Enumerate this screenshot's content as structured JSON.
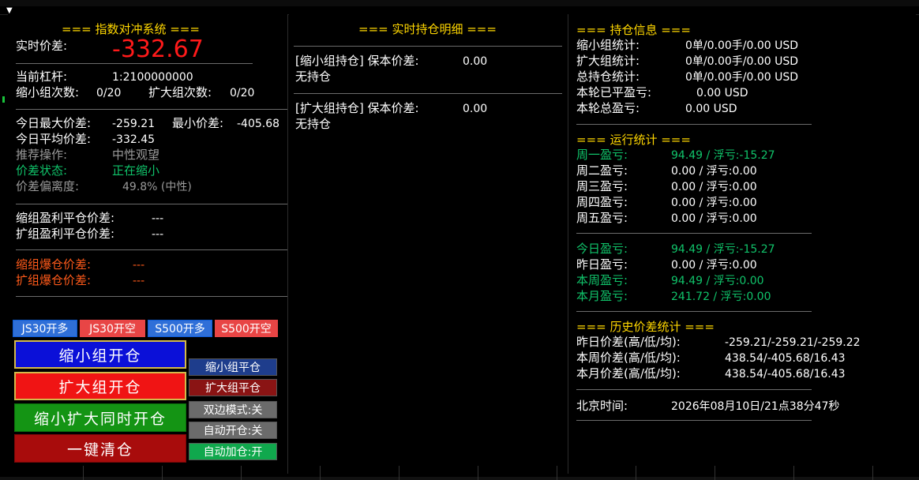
{
  "left": {
    "title": "=== 指数对冲系统 ===",
    "realtime_label": "实时价差:",
    "realtime_value": "-332.67",
    "leverage_label": "当前杠杆:",
    "leverage_value": "1:2100000000",
    "shrink_count_label": "缩小组次数:",
    "shrink_count_value": "0/20",
    "expand_count_label": "扩大组次数:",
    "expand_count_value": "0/20",
    "today_max_label": "今日最大价差:",
    "today_max_value": "-259.21",
    "today_min_label": "最小价差:",
    "today_min_value": "-405.68",
    "today_avg_label": "今日平均价差:",
    "today_avg_value": "-332.45",
    "recommend_label": "推荐操作:",
    "recommend_value": "中性观望",
    "spread_state_label": "价差状态:",
    "spread_state_value": "正在缩小",
    "deviation_label": "价差偏离度:",
    "deviation_value": "49.8% (中性)",
    "shrink_profit_label": "缩组盈利平仓价差:",
    "shrink_profit_value": "---",
    "expand_profit_label": "扩组盈利平仓价差:",
    "expand_profit_value": "---",
    "shrink_burst_label": "缩组爆仓价差:",
    "shrink_burst_value": "---",
    "expand_burst_label": "扩组爆仓价差:",
    "expand_burst_value": "---",
    "quick_buttons": [
      "JS30开多",
      "JS30开空",
      "S500开多",
      "S500开空"
    ],
    "btn_shrink_open": "缩小组开仓",
    "btn_expand_open": "扩大组开仓",
    "btn_both_open": "缩小扩大同时开仓",
    "btn_clear_all": "一键清仓",
    "btn_shrink_close": "缩小组平仓",
    "btn_expand_close": "扩大组平仓",
    "btn_dual_mode": "双边模式:关",
    "btn_auto_open": "自动开仓:关",
    "btn_auto_add": "自动加仓:开"
  },
  "middle": {
    "title": "=== 实时持仓明细 ===",
    "shrink_group_label": "[缩小组持仓] 保本价差:",
    "shrink_group_value": "0.00",
    "shrink_group_status": "无持仓",
    "expand_group_label": "[扩大组持仓] 保本价差:",
    "expand_group_value": "0.00",
    "expand_group_status": "无持仓"
  },
  "right": {
    "pos_title": "=== 持仓信息 ===",
    "shrink_stat_label": "缩小组统计:",
    "shrink_stat_value": "0单/0.00手/0.00 USD",
    "expand_stat_label": "扩大组统计:",
    "expand_stat_value": "0单/0.00手/0.00 USD",
    "total_stat_label": "总持仓统计:",
    "total_stat_value": "0单/0.00手/0.00 USD",
    "round_closed_label": "本轮已平盈亏:",
    "round_closed_value": "0.00 USD",
    "round_total_label": "本轮总盈亏:",
    "round_total_value": "0.00 USD",
    "run_title": "=== 运行统计 ===",
    "mon_label": "周一盈亏:",
    "mon_value": "94.49 / 浮亏:-15.27",
    "tue_label": "周二盈亏:",
    "tue_value": "0.00 / 浮亏:0.00",
    "wed_label": "周三盈亏:",
    "wed_value": "0.00 / 浮亏:0.00",
    "thu_label": "周四盈亏:",
    "thu_value": "0.00 / 浮亏:0.00",
    "fri_label": "周五盈亏:",
    "fri_value": "0.00 / 浮亏:0.00",
    "today_label": "今日盈亏:",
    "today_value": "94.49 / 浮亏:-15.27",
    "yesterday_label": "昨日盈亏:",
    "yesterday_value": "0.00 / 浮亏:0.00",
    "week_label": "本周盈亏:",
    "week_value": "94.49 / 浮亏:0.00",
    "month_label": "本月盈亏:",
    "month_value": "241.72 / 浮亏:0.00",
    "hist_title": "=== 历史价差统计 ===",
    "hist_yesterday_label": "昨日价差(高/低/均):",
    "hist_yesterday_value": "-259.21/-259.21/-259.22",
    "hist_week_label": "本周价差(高/低/均):",
    "hist_week_value": "438.54/-405.68/16.43",
    "hist_month_label": "本月价差(高/低/均):",
    "hist_month_value": "438.54/-405.68/16.43",
    "beijing_label": "北京时间:",
    "beijing_value": "2026年08月10日/21点38分47秒"
  }
}
